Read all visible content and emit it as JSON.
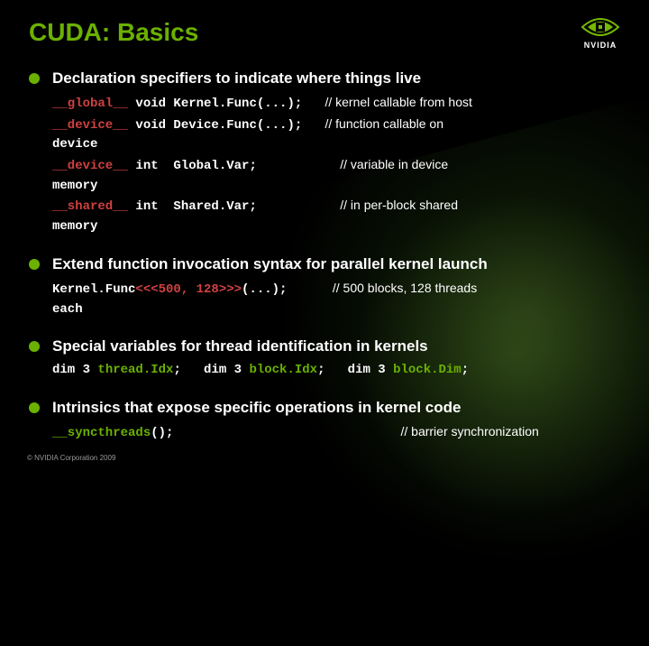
{
  "title": "CUDA: Basics",
  "logo_text": "NVIDIA",
  "sections": [
    {
      "title": "Declaration specifiers to indicate where things live",
      "lines": [
        {
          "code_html": "<span class='hl-red'>__global__</span> void Kernel.Func(...);",
          "comment": "// kernel callable from host",
          "pad": 3
        },
        {
          "code_html": "<span class='hl-red'>__device__</span> void Device.Func(...);",
          "comment": "// function callable on",
          "pad": 3
        },
        {
          "code_html": "device",
          "comment": "",
          "pad": 0
        },
        {
          "code_html": "<span class='hl-red'>__device__</span> int  Global.Var;",
          "comment": "// variable in device",
          "pad": 11
        },
        {
          "code_html": "memory",
          "comment": "",
          "pad": 0
        },
        {
          "code_html": "<span class='hl-red'>__shared__</span> int  Shared.Var;",
          "comment": "// in per-block shared",
          "pad": 11
        },
        {
          "code_html": "memory",
          "comment": "",
          "pad": 0
        }
      ]
    },
    {
      "title": "Extend function invocation syntax for parallel kernel launch",
      "lines": [
        {
          "code_html": "Kernel.Func<span class='hl-red'>&lt;&lt;&lt;500, 128&gt;&gt;&gt;</span>(...);",
          "comment": "// 500 blocks, 128 threads",
          "pad": 6
        },
        {
          "code_html": "each",
          "comment": "",
          "pad": 0
        }
      ]
    },
    {
      "title": "Special variables for thread identification in kernels",
      "lines": [
        {
          "code_html": "dim 3 <span class='hl-green'>thread.Idx</span>;   dim 3 <span class='hl-green'>block.Idx</span>;   dim 3 <span class='hl-green'>block.Dim</span>;",
          "comment": "",
          "pad": 0
        }
      ]
    },
    {
      "title": "Intrinsics that expose specific operations in kernel code",
      "lines": [
        {
          "code_html": "<span class='hl-green'>__syncthreads</span>();",
          "comment": "// barrier synchronization",
          "pad": 30
        }
      ]
    }
  ],
  "footer": "© NVIDIA Corporation 2009"
}
